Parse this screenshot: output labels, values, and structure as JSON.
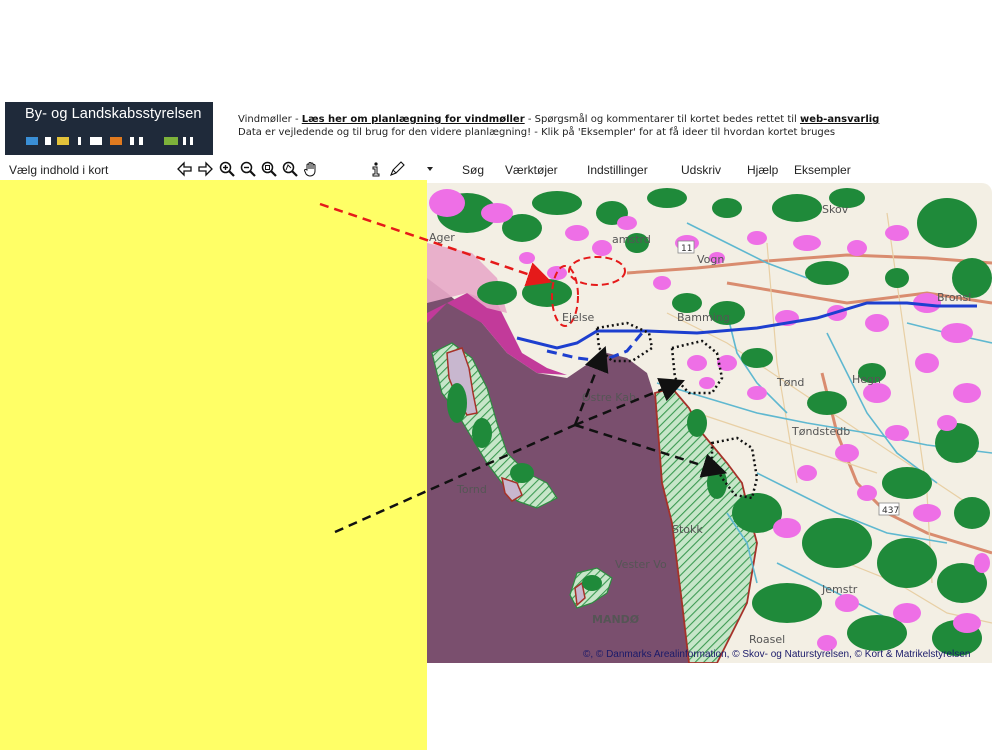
{
  "logo": {
    "title": "By- og Landskabsstyrelsen",
    "bar_colors": [
      "#3a8fd6",
      "#e3c23a",
      "#ffffff",
      "#e07a1f",
      "#ffffff",
      "#7db23a",
      "#ffffff"
    ]
  },
  "notice": {
    "line1_prefix": "Vindmøller - ",
    "line1_link": "Læs her om planlægning for vindmøller",
    "line1_middle": " - Spørgsmål og kommentarer til kortet bedes rettet til ",
    "line1_link2": "web-ansvarlig",
    "line2": "Data er vejledende og til brug for den videre planlægning! - Klik på 'Eksempler' for at få ideer til hvordan kortet bruges"
  },
  "toolbar": {
    "content_label": "Vælg indhold i kort",
    "tools": [
      "arrow-left-icon",
      "arrow-right-icon",
      "zoom-in-icon",
      "zoom-out-icon",
      "zoom-extent-icon",
      "zoom-select-icon",
      "pan-hand-icon",
      "info-icon",
      "pen-icon",
      "dropdown-icon"
    ],
    "menu": [
      "Søg",
      "Værktøjer",
      "Indstillinger",
      "Udskriv",
      "Hjælp",
      "Eksempler"
    ]
  },
  "map": {
    "place_labels": [
      "Vogn",
      "Bamming",
      "Ejelse",
      "Bronsl",
      "amstrd",
      "Tøndstedb",
      "Tønd",
      "Skov",
      "Ager",
      "Østre Kab",
      "Vester Vo",
      "MANDØ",
      "Roasel",
      "Hegn",
      "Jemstr",
      "Tornd",
      "Stokk"
    ],
    "road_label": "437",
    "road_label2": "11",
    "copyright": "©, © Danmarks Arealinformation, © Skov- og Naturstyrelsen, © Kort & Matrikelstyrelsen",
    "colors": {
      "sea": "#7a4f6e",
      "land": "#f3efe4",
      "forest": "#1f8a3a",
      "wind_zone": "#ee6fe6",
      "nature_hatch": "#47a35c",
      "boundary": "#a6322a",
      "blue_line": "#1d3fcf",
      "red_arrow": "#e51a1a",
      "black_arrow": "#111111",
      "town": "#e0a0c0"
    }
  }
}
